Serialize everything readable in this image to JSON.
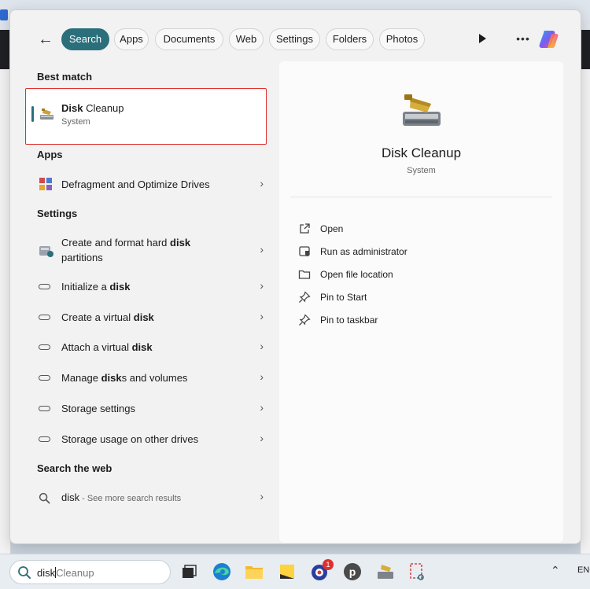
{
  "filter_tabs": [
    "Search",
    "Apps",
    "Documents",
    "Web",
    "Settings",
    "Folders",
    "Photos"
  ],
  "accent_color": "#2b6f7b",
  "highlight_color": "#e0302c",
  "sections": {
    "best_match": "Best match",
    "apps": "Apps",
    "settings": "Settings",
    "web": "Search the web"
  },
  "best_match": {
    "title_bold": "Disk",
    "title_rest": " Cleanup",
    "subtitle": "System"
  },
  "apps": [
    {
      "label": "Defragment and Optimize Drives",
      "icon": "defrag-icon"
    }
  ],
  "settings": [
    {
      "pre": "Create and format hard ",
      "bold": "disk",
      "post": "",
      "line2": "partitions",
      "icon": "disk-management-icon"
    },
    {
      "pre": "Initialize a ",
      "bold": "disk",
      "post": "",
      "icon": "drive-icon"
    },
    {
      "pre": "Create a virtual ",
      "bold": "disk",
      "post": "",
      "icon": "drive-icon"
    },
    {
      "pre": "Attach a virtual ",
      "bold": "disk",
      "post": "",
      "icon": "drive-icon"
    },
    {
      "pre": "Manage ",
      "bold": "disk",
      "post": "s and volumes",
      "icon": "drive-icon"
    },
    {
      "pre": "Storage settings",
      "bold": "",
      "post": "",
      "icon": "drive-icon"
    },
    {
      "pre": "Storage usage on other drives",
      "bold": "",
      "post": "",
      "icon": "drive-icon"
    }
  ],
  "web": {
    "query": "disk",
    "separator": " - ",
    "more": "See more search results"
  },
  "preview": {
    "title": "Disk Cleanup",
    "subtitle": "System",
    "actions": [
      {
        "label": "Open",
        "icon": "open-external-icon"
      },
      {
        "label": "Run as administrator",
        "icon": "shield-icon"
      },
      {
        "label": "Open file location",
        "icon": "folder-icon"
      },
      {
        "label": "Pin to Start",
        "icon": "pin-icon"
      },
      {
        "label": "Pin to taskbar",
        "icon": "pin-icon"
      }
    ]
  },
  "taskbar": {
    "search_typed": "disk",
    "search_suggest": "Cleanup",
    "notification_count": "1",
    "language": "ENG"
  }
}
